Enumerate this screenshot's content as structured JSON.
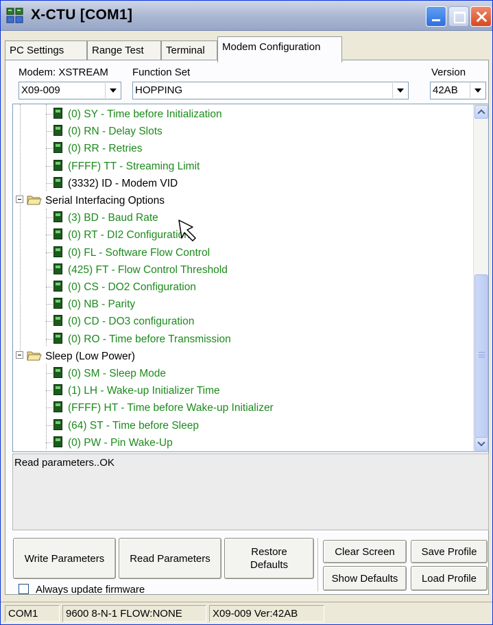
{
  "window": {
    "title": "X-CTU  [COM1]"
  },
  "tabs": [
    {
      "label": "PC Settings"
    },
    {
      "label": "Range Test"
    },
    {
      "label": "Terminal"
    },
    {
      "label": "Modem Configuration",
      "active": true
    }
  ],
  "modem": {
    "label": "Modem: XSTREAM",
    "value": "X09-009",
    "function_set_label": "Function Set",
    "function_set_value": "HOPPING",
    "version_label": "Version",
    "version_value": "42AB"
  },
  "tree": {
    "rows": [
      {
        "kind": "param",
        "text": "(0) SY - Time before Initialization",
        "color": "green"
      },
      {
        "kind": "param",
        "text": "(0) RN - Delay Slots",
        "color": "green"
      },
      {
        "kind": "param",
        "text": "(0) RR - Retries",
        "color": "green"
      },
      {
        "kind": "param",
        "text": "(FFFF) TT - Streaming Limit",
        "color": "green"
      },
      {
        "kind": "param",
        "text": "(3332) ID - Modem VID",
        "color": "black"
      },
      {
        "kind": "category",
        "text": "Serial Interfacing Options"
      },
      {
        "kind": "param",
        "text": "(3) BD - Baud Rate",
        "color": "green"
      },
      {
        "kind": "param",
        "text": "(0) RT - DI2 Configuration",
        "color": "green"
      },
      {
        "kind": "param",
        "text": "(0) FL - Software Flow Control",
        "color": "green"
      },
      {
        "kind": "param",
        "text": "(425) FT - Flow Control Threshold",
        "color": "green"
      },
      {
        "kind": "param",
        "text": "(0) CS - DO2 Configuration",
        "color": "green"
      },
      {
        "kind": "param",
        "text": "(0) NB - Parity",
        "color": "green"
      },
      {
        "kind": "param",
        "text": "(0) CD - DO3 configuration",
        "color": "green"
      },
      {
        "kind": "param",
        "text": "(0) RO - Time before Transmission",
        "color": "green"
      },
      {
        "kind": "category",
        "text": "Sleep (Low Power)"
      },
      {
        "kind": "param",
        "text": "(0) SM - Sleep Mode",
        "color": "green"
      },
      {
        "kind": "param",
        "text": "(1) LH - Wake-up Initializer Time",
        "color": "green"
      },
      {
        "kind": "param",
        "text": "(FFFF) HT - Time before Wake-up Initializer",
        "color": "green"
      },
      {
        "kind": "param",
        "text": "(64) ST - Time before Sleep",
        "color": "green"
      },
      {
        "kind": "param",
        "text": "(0) PW - Pin Wake-Up",
        "color": "green"
      }
    ]
  },
  "log": {
    "text": "Read parameters..OK"
  },
  "buttons": {
    "write": "Write Parameters",
    "read": "Read Parameters",
    "restore_line1": "Restore",
    "restore_line2": "Defaults",
    "clear_screen": "Clear Screen",
    "save_profile": "Save Profile",
    "show_defaults": "Show Defaults",
    "load_profile": "Load Profile"
  },
  "checkbox": {
    "label": "Always update firmware",
    "checked": false
  },
  "statusbar": {
    "port": "COM1",
    "settings": "9600 8-N-1  FLOW:NONE",
    "modem": "X09-009  Ver:42AB"
  },
  "colors": {
    "param_green": "#1c8a1c",
    "title_bar": "#a9b6d2",
    "window_bg": "#ece9d8"
  }
}
